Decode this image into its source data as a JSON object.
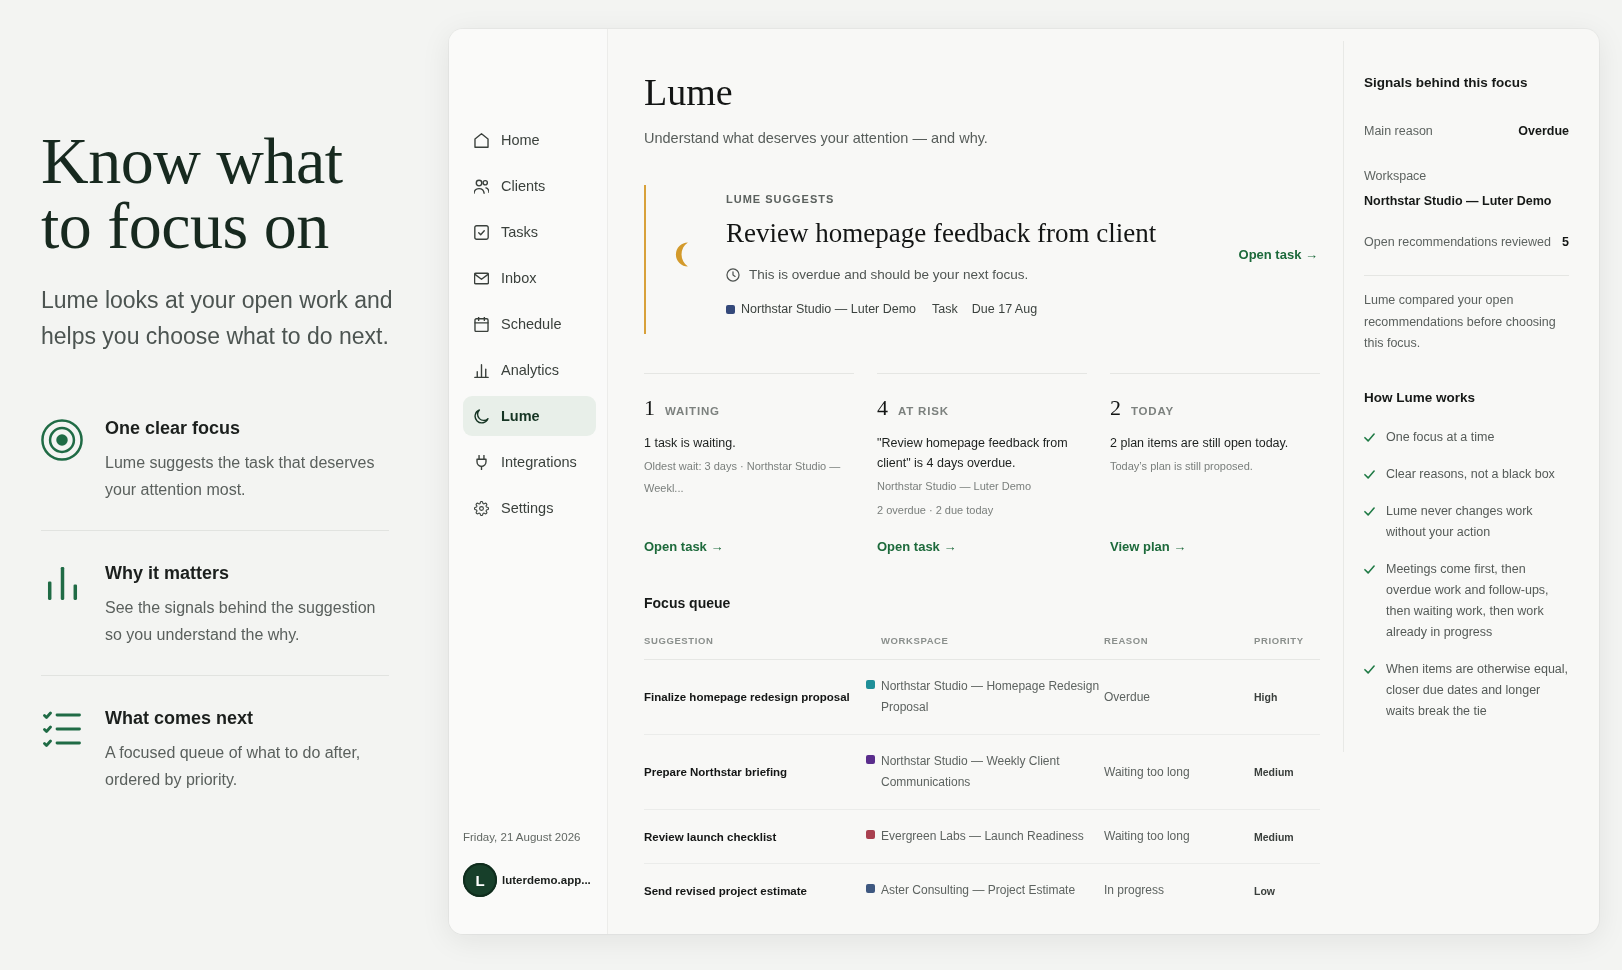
{
  "hero": {
    "title": "Know what to focus on",
    "subtitle": "Lume looks at your open work and helps you choose what to do next.",
    "features": [
      {
        "title": "One clear focus",
        "text": "Lume suggests the task that deserves your attention most."
      },
      {
        "title": "Why it matters",
        "text": "See the signals behind the suggestion so you understand the why."
      },
      {
        "title": "What comes next",
        "text": "A focused queue of what to do after, ordered by priority."
      }
    ]
  },
  "sidebar": {
    "items": [
      {
        "label": "Home",
        "selected": false
      },
      {
        "label": "Clients",
        "selected": false
      },
      {
        "label": "Tasks",
        "selected": false
      },
      {
        "label": "Inbox",
        "selected": false
      },
      {
        "label": "Schedule",
        "selected": false
      },
      {
        "label": "Analytics",
        "selected": false
      },
      {
        "label": "Lume",
        "selected": true
      },
      {
        "label": "Integrations",
        "selected": false
      },
      {
        "label": "Settings",
        "selected": false
      }
    ],
    "date": "Friday, 21 August 2026",
    "account": {
      "initial": "L",
      "name": "luterdemo.app..."
    }
  },
  "main": {
    "title": "Lume",
    "subtitle": "Understand what deserves your attention — and why.",
    "suggestion": {
      "eyebrow": "LUME SUGGESTS",
      "title": "Review homepage feedback from client",
      "reason": "This is overdue and should be your next focus.",
      "workspace": "Northstar Studio — Luter Demo",
      "type": "Task",
      "due": "Due 17 Aug",
      "action": "Open task →"
    },
    "stats": [
      {
        "count": "1",
        "label": "WAITING",
        "summary": "1 task is waiting.",
        "details": [
          "Oldest wait: 3 days · Northstar Studio — Weekl..."
        ],
        "action": "Open task →"
      },
      {
        "count": "4",
        "label": "AT RISK",
        "summary": "\"Review homepage feedback from client\" is 4 days overdue.",
        "details": [
          "Northstar Studio — Luter Demo",
          "2 overdue · 2 due today"
        ],
        "action": "Open task →"
      },
      {
        "count": "2",
        "label": "TODAY",
        "summary": "2 plan items are still open today.",
        "details": [
          "Today’s plan is still proposed."
        ],
        "action": "View plan →"
      }
    ],
    "queue": {
      "title": "Focus queue",
      "columns": [
        "SUGGESTION",
        "WORKSPACE",
        "REASON",
        "PRIORITY"
      ],
      "rows": [
        {
          "suggestion": "Finalize homepage redesign proposal",
          "workspace": "Northstar Studio — Homepage Redesign Proposal",
          "color": "#1f8f98",
          "reason": "Overdue",
          "priority": "High"
        },
        {
          "suggestion": "Prepare Northstar briefing",
          "workspace": "Northstar Studio — Weekly Client Communications",
          "color": "#5a2d8c",
          "reason": "Waiting too long",
          "priority": "Medium"
        },
        {
          "suggestion": "Review launch checklist",
          "workspace": "Evergreen Labs — Launch Readiness",
          "color": "#a9404f",
          "reason": "Waiting too long",
          "priority": "Medium"
        },
        {
          "suggestion": "Send revised project estimate",
          "workspace": "Aster Consulting — Project Estimate",
          "color": "#3e5880",
          "reason": "In progress",
          "priority": "Low"
        }
      ]
    }
  },
  "signals": {
    "title": "Signals behind this focus",
    "facts": [
      {
        "kind": "inline",
        "label": "Main reason",
        "value": "Overdue"
      },
      {
        "kind": "stacked",
        "label": "Workspace",
        "value": "Northstar Studio — Luter Demo"
      },
      {
        "kind": "inline",
        "label": "Open recommendations reviewed",
        "value": "5"
      }
    ],
    "note": "Lume compared your open recommendations before choosing this focus.",
    "how_title": "How Lume works",
    "how_items": [
      "One focus at a time",
      "Clear reasons, not a black box",
      "Lume never changes work without your action",
      "Meetings come first, then overdue work and follow-ups, then waiting work, then work already in progress",
      "When items are otherwise equal, closer due dates and longer waits break the tie"
    ]
  }
}
